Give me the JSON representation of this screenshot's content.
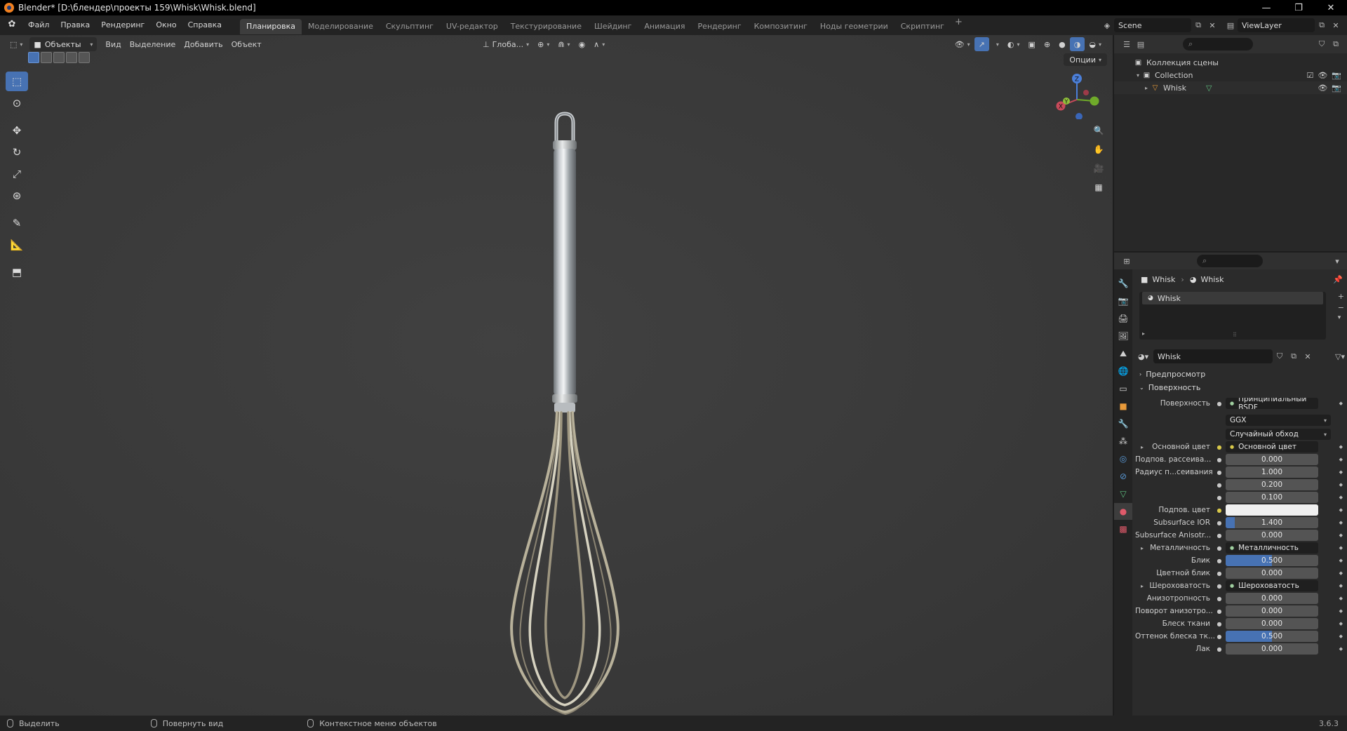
{
  "window": {
    "title": "Blender* [D:\\блендер\\проекты 159\\Whisk\\Whisk.blend]",
    "minimize": "—",
    "maximize": "❐",
    "close": "✕"
  },
  "menu": [
    "Файл",
    "Правка",
    "Рендеринг",
    "Окно",
    "Справка"
  ],
  "workspaces": [
    "Планировка",
    "Моделирование",
    "Скульптинг",
    "UV-редактор",
    "Текстурирование",
    "Шейдинг",
    "Анимация",
    "Рендеринг",
    "Композитинг",
    "Ноды геометрии",
    "Скриптинг"
  ],
  "active_workspace": "Планировка",
  "scene": {
    "name": "Scene",
    "view_layer": "ViewLayer"
  },
  "viewport": {
    "mode": "Объекты",
    "menus": [
      "Вид",
      "Выделение",
      "Добавить",
      "Объект"
    ],
    "transform_orientation": "Глоба...",
    "options": "Опции",
    "gizmo": {
      "x": "X",
      "y": "Y",
      "z": "Z"
    }
  },
  "outliner": {
    "scene_collection": "Коллекция сцены",
    "collection": "Collection",
    "object": "Whisk"
  },
  "properties": {
    "breadcrumb": [
      "Whisk",
      "Whisk"
    ],
    "slot": "Whisk",
    "material_name": "Whisk",
    "panels": {
      "preview": "Предпросмотр",
      "surface": "Поверхность"
    },
    "rows": [
      {
        "label": "Поверхность",
        "value": "Принципиальный BSDF",
        "kind": "link"
      },
      {
        "label": "",
        "value": "GGX",
        "kind": "dropdown"
      },
      {
        "label": "",
        "value": "Случайный обход",
        "kind": "dropdown"
      },
      {
        "label": "Основной цвет",
        "value": "Основной цвет",
        "kind": "link",
        "expand": true,
        "dot": "yellow"
      },
      {
        "label": "Подпов. рассеива...",
        "value": "0.000",
        "kind": "num"
      },
      {
        "label": "Радиус п...сеивания",
        "value": "1.000",
        "kind": "num"
      },
      {
        "label": "",
        "value": "0.200",
        "kind": "num"
      },
      {
        "label": "",
        "value": "0.100",
        "kind": "num"
      },
      {
        "label": "Подпов. цвет",
        "value": "",
        "kind": "color",
        "dot": "yellow"
      },
      {
        "label": "Subsurface IOR",
        "value": "1.400",
        "kind": "num",
        "fill": 0.1
      },
      {
        "label": "Subsurface Anisotr...",
        "value": "0.000",
        "kind": "num"
      },
      {
        "label": "Металличность",
        "value": "Металличность",
        "kind": "link",
        "expand": true
      },
      {
        "label": "Блик",
        "value": "0.500",
        "kind": "num",
        "fill": 0.5
      },
      {
        "label": "Цветной блик",
        "value": "0.000",
        "kind": "num"
      },
      {
        "label": "Шероховатость",
        "value": "Шероховатость",
        "kind": "link",
        "expand": true
      },
      {
        "label": "Анизотропность",
        "value": "0.000",
        "kind": "num"
      },
      {
        "label": "Поворот анизотро...",
        "value": "0.000",
        "kind": "num"
      },
      {
        "label": "Блеск ткани",
        "value": "0.000",
        "kind": "num"
      },
      {
        "label": "Оттенок блеска тк...",
        "value": "0.500",
        "kind": "num",
        "fill": 0.5
      },
      {
        "label": "Лак",
        "value": "0.000",
        "kind": "num"
      }
    ]
  },
  "status": {
    "select": "Выделить",
    "rotate": "Повернуть вид",
    "context": "Контекстное меню объектов",
    "version": "3.6.3"
  },
  "colors": {
    "accent": "#4772b3",
    "viewport_bg": "#3a3a3a",
    "panel_bg": "#2b2b2b"
  }
}
